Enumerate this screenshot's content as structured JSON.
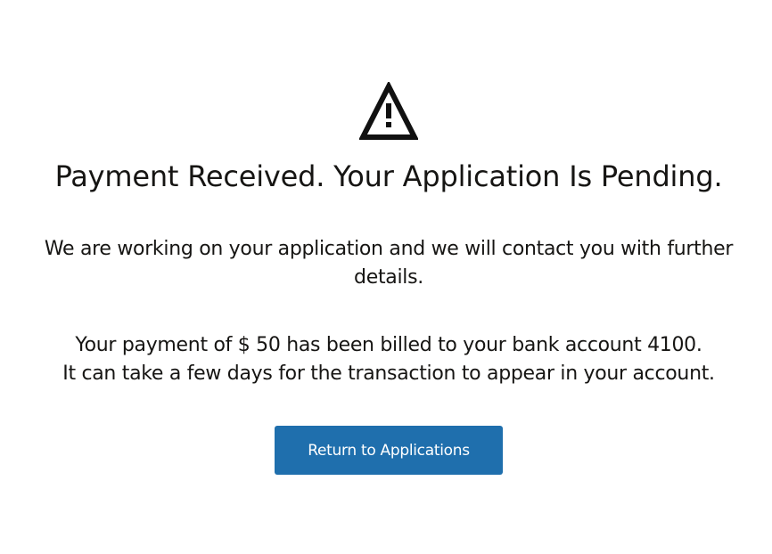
{
  "status": {
    "icon": "warning-icon",
    "title": "Payment Received. Your Application Is Pending.",
    "message": "We are working on your application and we will contact you with further details.",
    "billing_line1": "Your payment of $ 50 has been billed to your bank account 4100.",
    "billing_line2": "It can take a few days for the transaction to appear in your account."
  },
  "actions": {
    "return_label": "Return to Applications"
  },
  "colors": {
    "primary_button": "#1f6fad",
    "text": "#161513",
    "background": "#ffffff"
  }
}
